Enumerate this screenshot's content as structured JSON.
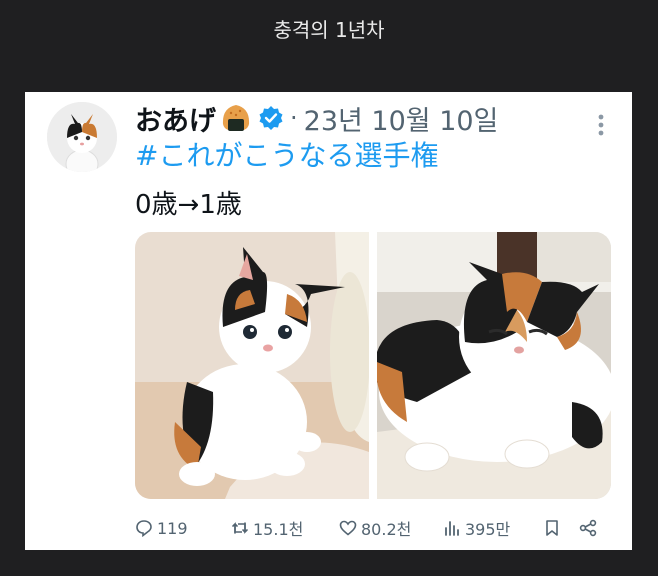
{
  "page": {
    "title": "충격의 1년차"
  },
  "tweet": {
    "author_name": "おあげ",
    "date": "23년 10월 10일",
    "separator": "·",
    "hashtag": "#これがこうなる選手権",
    "text": "0歳→1歳",
    "verified_color": "#1d9bf0",
    "link_color": "#1d9bf0",
    "images": [
      {
        "icon": "kitten-photo"
      },
      {
        "icon": "grown-cat-photo"
      }
    ],
    "actions": {
      "replies": "119",
      "retweets": "15.1천",
      "likes": "80.2천",
      "views": "395만"
    }
  }
}
